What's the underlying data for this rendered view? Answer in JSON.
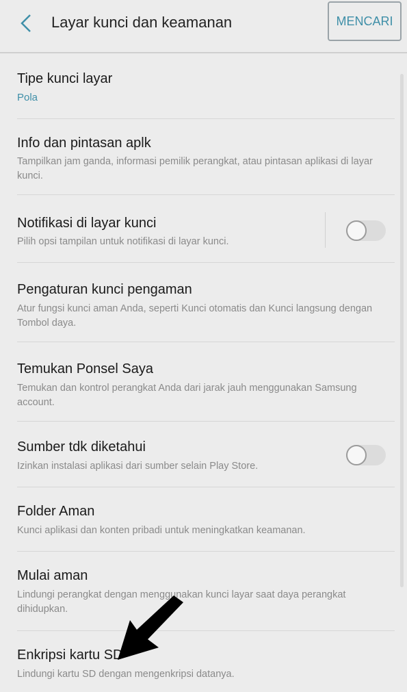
{
  "header": {
    "title": "Layar kunci dan keamanan",
    "search_label": "MENCARI",
    "back_icon": "chevron-left-icon"
  },
  "items": [
    {
      "title": "Tipe kunci layar",
      "subtitle": "Pola"
    },
    {
      "title": "Info dan pintasan aplk",
      "subtitle": "Tampilkan jam ganda, informasi pemilik perangkat, atau pintasan aplikasi di layar kunci."
    },
    {
      "title": "Notifikasi di layar kunci",
      "subtitle": "Pilih opsi tampilan untuk notifikasi di layar kunci.",
      "toggle": false
    },
    {
      "title": "Pengaturan kunci pengaman",
      "subtitle": "Atur fungsi kunci aman Anda, seperti Kunci otomatis dan Kunci langsung dengan Tombol daya."
    },
    {
      "title": "Temukan Ponsel Saya",
      "subtitle": "Temukan dan kontrol perangkat Anda dari jarak jauh menggunakan Samsung account."
    },
    {
      "title": "Sumber tdk diketahui",
      "subtitle": "Izinkan instalasi aplikasi dari sumber selain Play Store.",
      "toggle": false
    },
    {
      "title": "Folder Aman",
      "subtitle": "Kunci aplikasi dan konten pribadi untuk meningkatkan keamanan."
    },
    {
      "title": "Mulai aman",
      "subtitle": "Lindungi perangkat dengan menggunakan kunci layar saat daya perangkat dihidupkan."
    },
    {
      "title": "Enkripsi kartu SD",
      "subtitle": "Lindungi kartu SD dengan mengenkripsi datanya."
    }
  ],
  "colors": {
    "accent": "#3f8fa8",
    "background": "#ececec",
    "arrow": "#000000"
  }
}
